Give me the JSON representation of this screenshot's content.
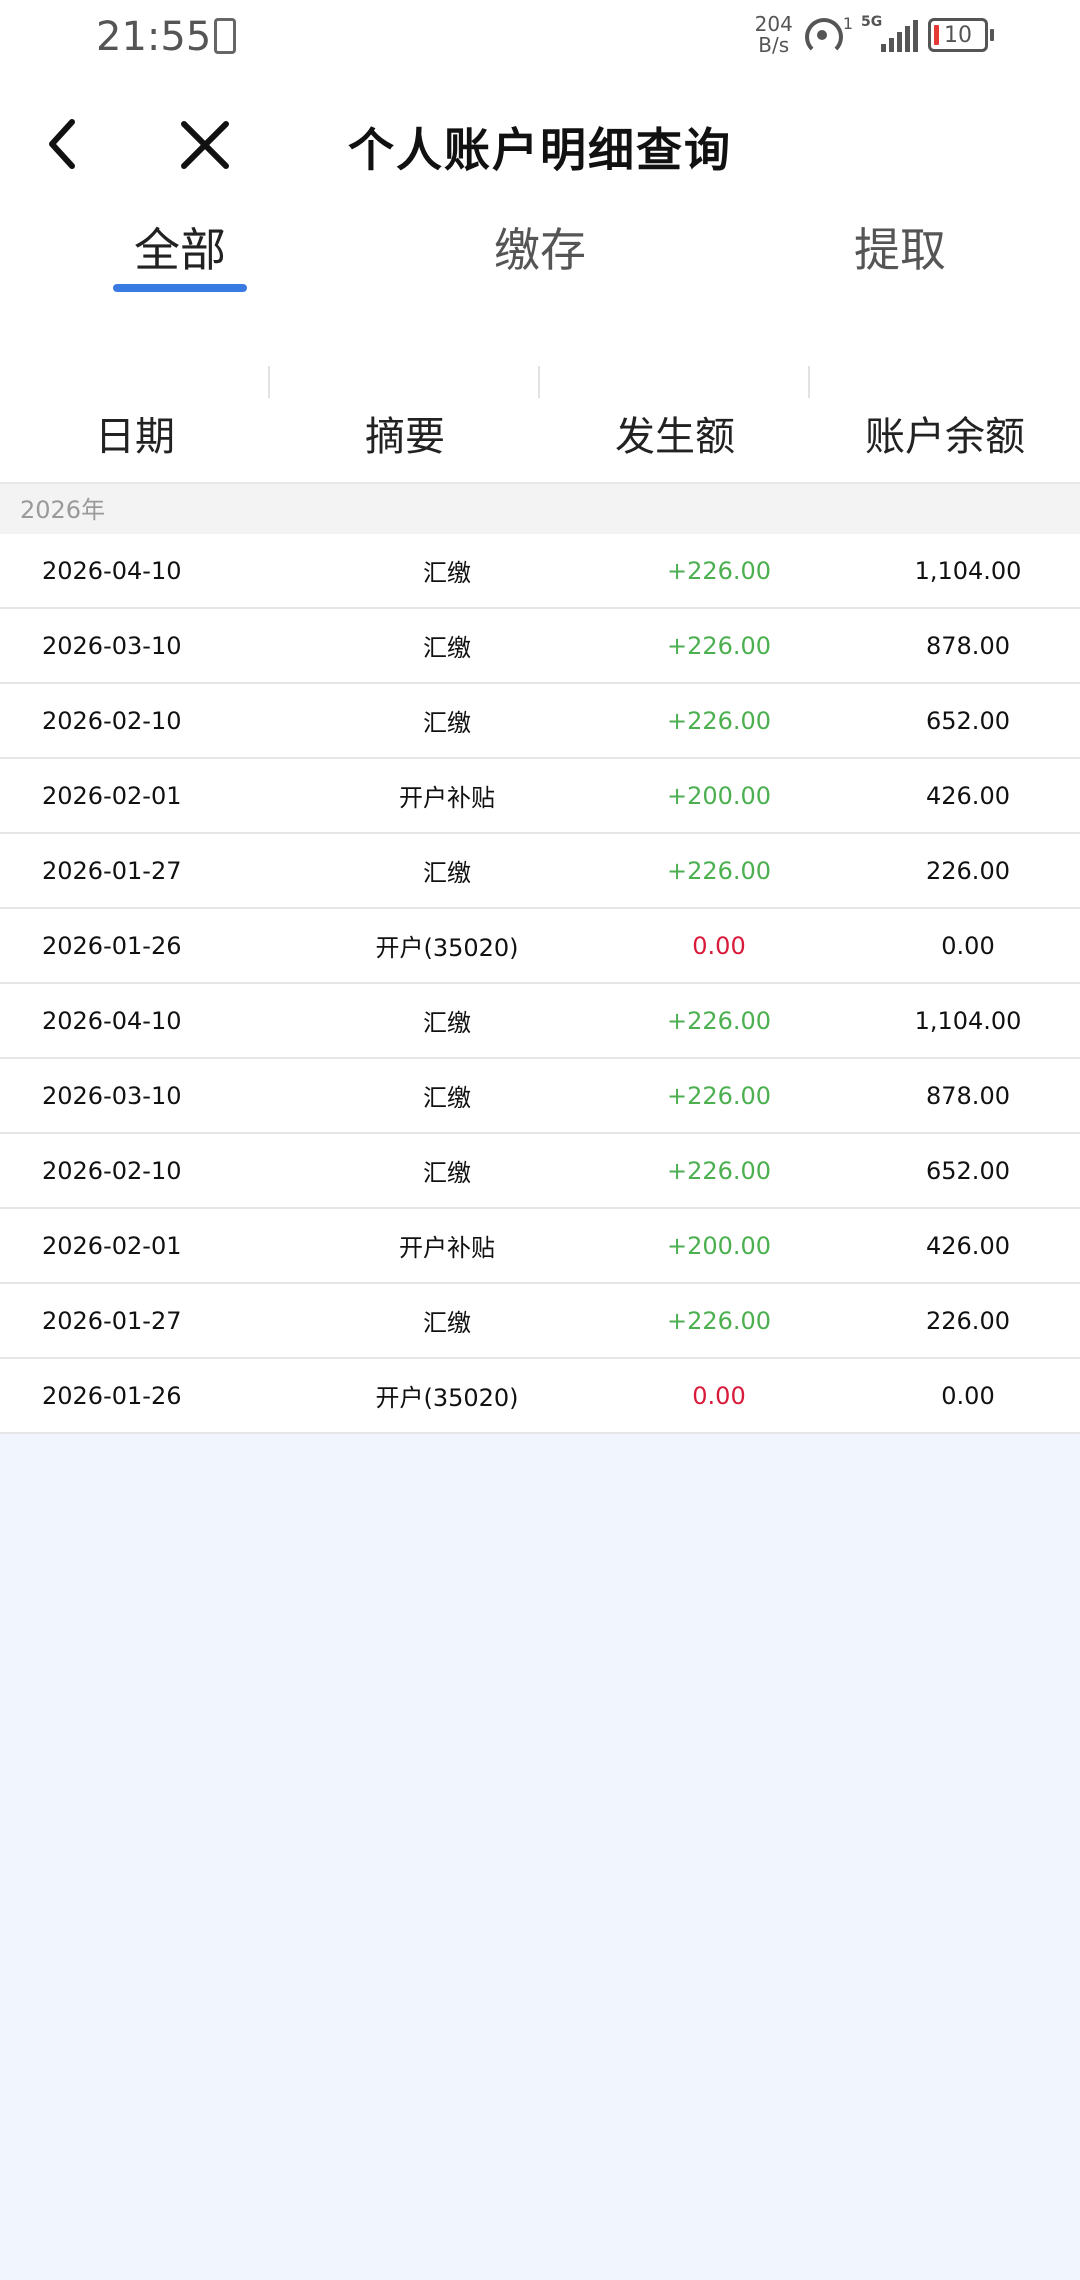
{
  "status_bar": {
    "time": "21:55",
    "speed_value": "204",
    "speed_unit": "B/s",
    "hotspot_count": "1",
    "network": "5G",
    "battery": "10"
  },
  "nav": {
    "title": "个人账户明细查询",
    "back_icon": "chevron-left-icon",
    "close_icon": "close-icon"
  },
  "tabs": [
    {
      "label": "全部",
      "active": true
    },
    {
      "label": "缴存",
      "active": false
    },
    {
      "label": "提取",
      "active": false
    }
  ],
  "table": {
    "columns": [
      "日期",
      "摘要",
      "发生额",
      "账户余额"
    ],
    "year_label": "2026年",
    "rows": [
      {
        "date": "2026-04-10",
        "summary": "汇缴",
        "amount": "+226.00",
        "balance": "1,104.00"
      },
      {
        "date": "2026-03-10",
        "summary": "汇缴",
        "amount": "+226.00",
        "balance": "878.00"
      },
      {
        "date": "2026-02-10",
        "summary": "汇缴",
        "amount": "+226.00",
        "balance": "652.00"
      },
      {
        "date": "2026-02-01",
        "summary": "开户补贴",
        "amount": "+200.00",
        "balance": "426.00"
      },
      {
        "date": "2026-01-27",
        "summary": "汇缴",
        "amount": "+226.00",
        "balance": "226.00"
      },
      {
        "date": "2026-01-26",
        "summary": "开户(35020)",
        "amount": "0.00",
        "balance": "0.00"
      },
      {
        "date": "2026-04-10",
        "summary": "汇缴",
        "amount": "+226.00",
        "balance": "1,104.00"
      },
      {
        "date": "2026-03-10",
        "summary": "汇缴",
        "amount": "+226.00",
        "balance": "878.00"
      },
      {
        "date": "2026-02-10",
        "summary": "汇缴",
        "amount": "+226.00",
        "balance": "652.00"
      },
      {
        "date": "2026-02-01",
        "summary": "开户补贴",
        "amount": "+200.00",
        "balance": "426.00"
      },
      {
        "date": "2026-01-27",
        "summary": "汇缴",
        "amount": "+226.00",
        "balance": "226.00"
      },
      {
        "date": "2026-01-26",
        "summary": "开户(35020)",
        "amount": "0.00",
        "balance": "0.00"
      }
    ]
  },
  "colors": {
    "accent": "#3a7be3",
    "positive": "#4caf50",
    "zero": "#d81b3a",
    "page_background": "#f1f5fd"
  }
}
